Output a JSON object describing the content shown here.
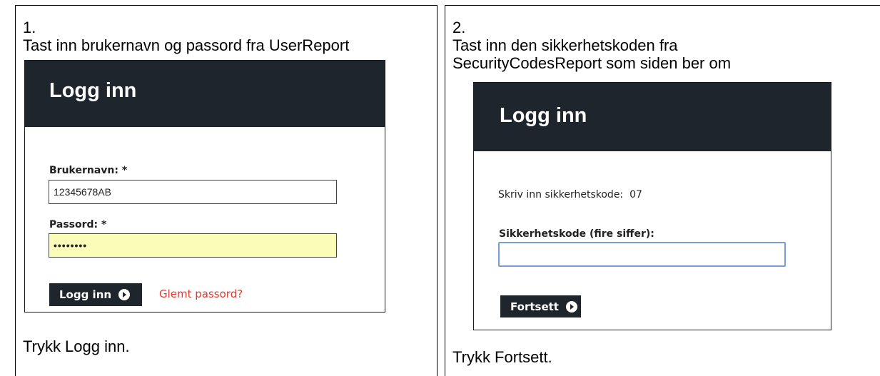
{
  "step1": {
    "number": "1.",
    "instruction": "Tast inn brukernavn og passord fra UserReport",
    "login_title": "Logg inn",
    "username_label": "Brukernavn: *",
    "username_value": "12345678AB",
    "password_label": "Passord: *",
    "password_value": "••••••••",
    "button_label": "Logg inn",
    "forgot_link": "Glemt passord?",
    "footer": "Trykk Logg inn."
  },
  "step2": {
    "number": "2.",
    "instruction_line1": "Tast inn den sikkerhetskoden fra",
    "instruction_line2": "SecurityCodesReport som siden ber om",
    "login_title": "Logg inn",
    "prompt_label": "Skriv inn sikkerhetskode:",
    "prompt_code": "07",
    "code_label": "Sikkerhetskode (fire siffer):",
    "code_value": "",
    "button_label": "Fortsett",
    "footer": "Trykk Fortsett."
  },
  "icons": {
    "button_icon": "arrow-circle-right-icon"
  },
  "colors": {
    "header_bg": "#1e252d",
    "password_bg": "#fafcb8",
    "link": "#e0392e",
    "code_border": "#7a9bd6"
  }
}
